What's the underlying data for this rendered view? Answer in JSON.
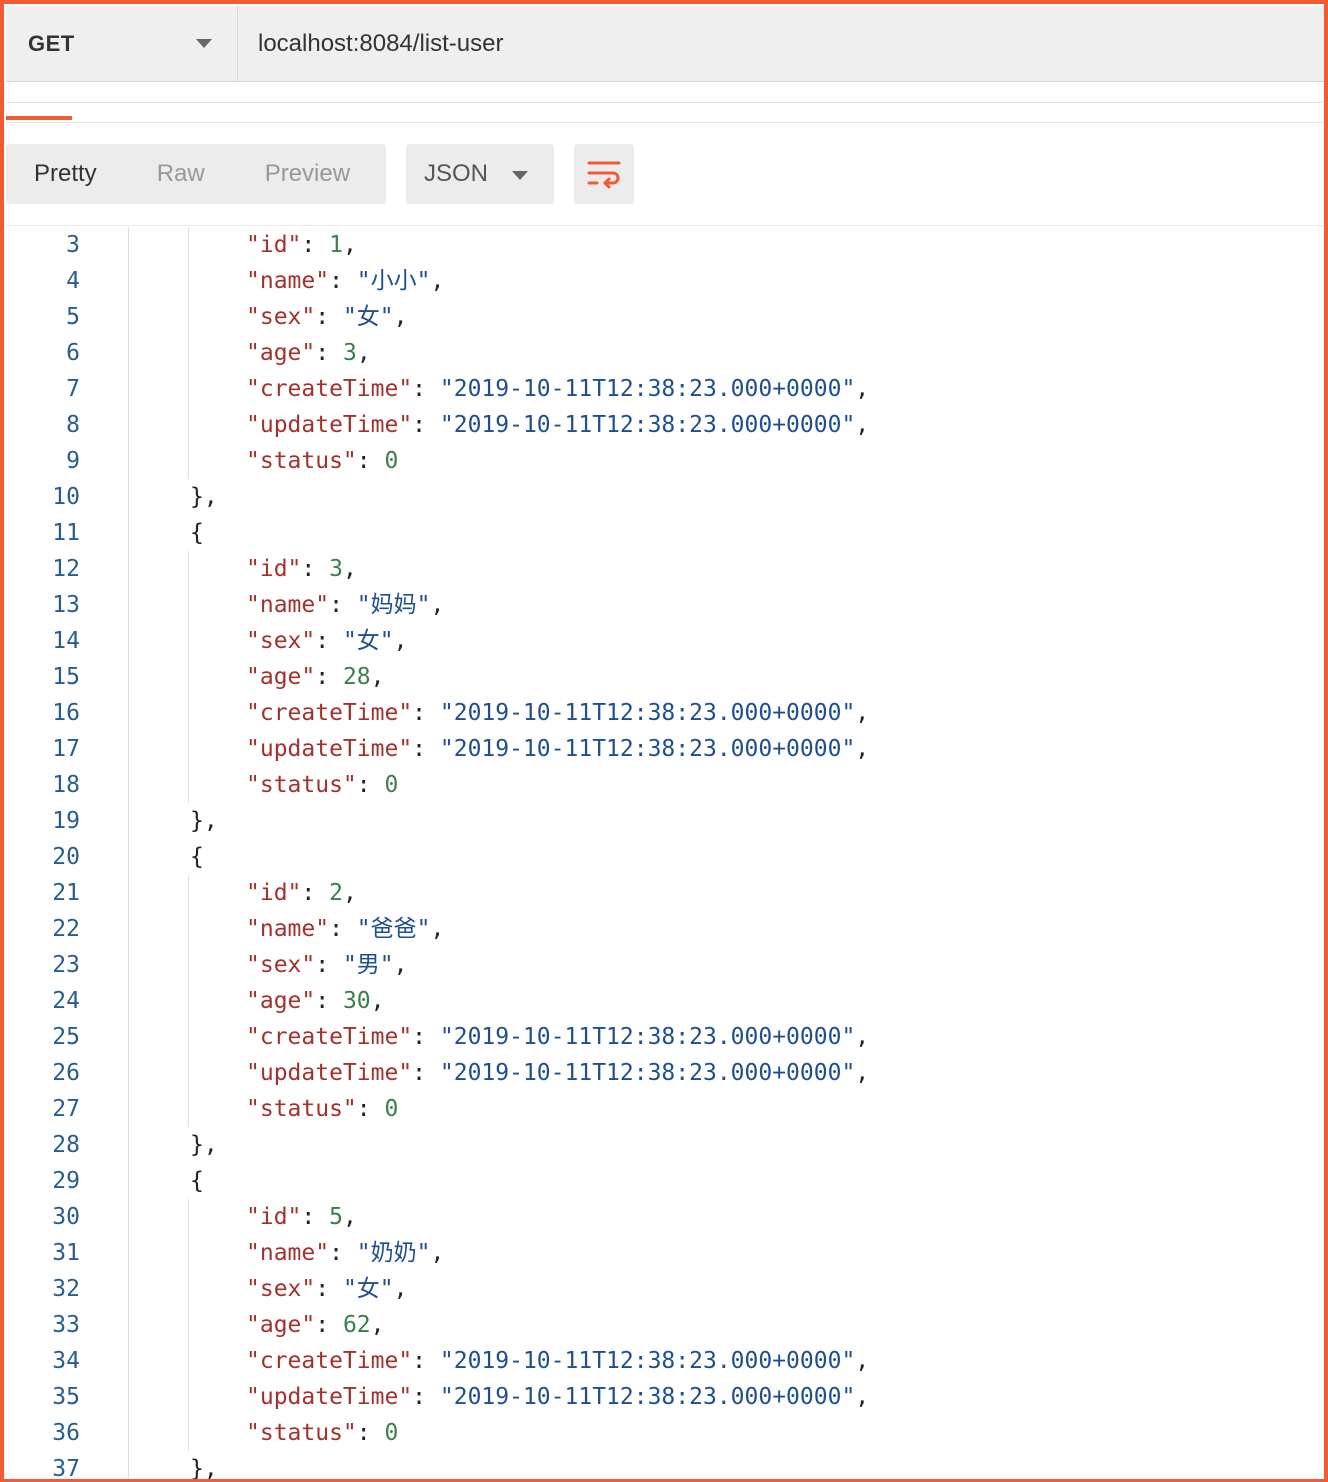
{
  "request": {
    "method": "GET",
    "url": "localhost:8084/list-user"
  },
  "toolbar": {
    "views": [
      "Pretty",
      "Raw",
      "Preview"
    ],
    "active_view": "Pretty",
    "format": "JSON",
    "wrap_icon": "wrap-lines-icon"
  },
  "colors": {
    "accent": "#ef5b35",
    "key": "#a3312d",
    "string": "#1f4f91",
    "number": "#3b7f4a",
    "line_number": "#2a5d8f"
  },
  "code": {
    "first_line_number": 3,
    "lines": [
      {
        "indent": 2,
        "key": "id",
        "num": "1",
        "comma": true
      },
      {
        "indent": 2,
        "key": "name",
        "str": "小小",
        "comma": true
      },
      {
        "indent": 2,
        "key": "sex",
        "str": "女",
        "comma": true
      },
      {
        "indent": 2,
        "key": "age",
        "num": "3",
        "comma": true
      },
      {
        "indent": 2,
        "key": "createTime",
        "str": "2019-10-11T12:38:23.000+0000",
        "comma": true
      },
      {
        "indent": 2,
        "key": "updateTime",
        "str": "2019-10-11T12:38:23.000+0000",
        "comma": true
      },
      {
        "indent": 2,
        "key": "status",
        "num": "0",
        "comma": false
      },
      {
        "indent": 1,
        "punct": "},"
      },
      {
        "indent": 1,
        "punct": "{"
      },
      {
        "indent": 2,
        "key": "id",
        "num": "3",
        "comma": true
      },
      {
        "indent": 2,
        "key": "name",
        "str": "妈妈",
        "comma": true
      },
      {
        "indent": 2,
        "key": "sex",
        "str": "女",
        "comma": true
      },
      {
        "indent": 2,
        "key": "age",
        "num": "28",
        "comma": true
      },
      {
        "indent": 2,
        "key": "createTime",
        "str": "2019-10-11T12:38:23.000+0000",
        "comma": true
      },
      {
        "indent": 2,
        "key": "updateTime",
        "str": "2019-10-11T12:38:23.000+0000",
        "comma": true
      },
      {
        "indent": 2,
        "key": "status",
        "num": "0",
        "comma": false
      },
      {
        "indent": 1,
        "punct": "},"
      },
      {
        "indent": 1,
        "punct": "{"
      },
      {
        "indent": 2,
        "key": "id",
        "num": "2",
        "comma": true
      },
      {
        "indent": 2,
        "key": "name",
        "str": "爸爸",
        "comma": true
      },
      {
        "indent": 2,
        "key": "sex",
        "str": "男",
        "comma": true
      },
      {
        "indent": 2,
        "key": "age",
        "num": "30",
        "comma": true
      },
      {
        "indent": 2,
        "key": "createTime",
        "str": "2019-10-11T12:38:23.000+0000",
        "comma": true
      },
      {
        "indent": 2,
        "key": "updateTime",
        "str": "2019-10-11T12:38:23.000+0000",
        "comma": true
      },
      {
        "indent": 2,
        "key": "status",
        "num": "0",
        "comma": false
      },
      {
        "indent": 1,
        "punct": "},"
      },
      {
        "indent": 1,
        "punct": "{"
      },
      {
        "indent": 2,
        "key": "id",
        "num": "5",
        "comma": true
      },
      {
        "indent": 2,
        "key": "name",
        "str": "奶奶",
        "comma": true
      },
      {
        "indent": 2,
        "key": "sex",
        "str": "女",
        "comma": true
      },
      {
        "indent": 2,
        "key": "age",
        "num": "62",
        "comma": true
      },
      {
        "indent": 2,
        "key": "createTime",
        "str": "2019-10-11T12:38:23.000+0000",
        "comma": true
      },
      {
        "indent": 2,
        "key": "updateTime",
        "str": "2019-10-11T12:38:23.000+0000",
        "comma": true
      },
      {
        "indent": 2,
        "key": "status",
        "num": "0",
        "comma": false
      },
      {
        "indent": 1,
        "punct": "},"
      }
    ]
  }
}
